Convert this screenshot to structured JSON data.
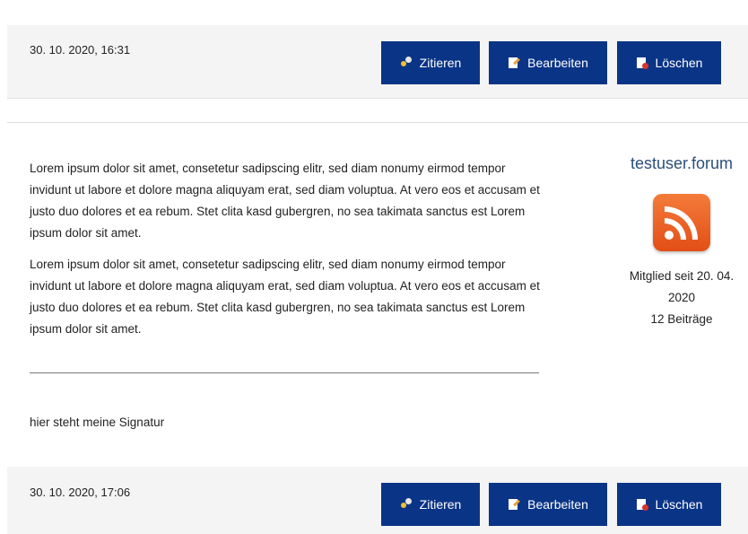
{
  "posts": [
    {
      "date": "30. 10. 2020, 16:31",
      "actions": {
        "quote_label": "Zitieren",
        "edit_label": "Bearbeiten",
        "delete_label": "Löschen"
      }
    },
    {
      "date": "30. 10. 2020, 17:06",
      "actions": {
        "quote_label": "Zitieren",
        "edit_label": "Bearbeiten",
        "delete_label": "Löschen"
      }
    }
  ],
  "post_content": {
    "paragraphs": [
      "Lorem ipsum dolor sit amet, consetetur sadipscing elitr, sed diam nonumy eirmod tempor invidunt ut labore et dolore magna aliquyam erat, sed diam voluptua. At vero eos et accusam et justo duo dolores et ea rebum. Stet clita kasd gubergren, no sea takimata sanctus est Lorem ipsum dolor sit amet.",
      "Lorem ipsum dolor sit amet, consetetur sadipscing elitr, sed diam nonumy eirmod tempor invidunt ut labore et dolore magna aliquyam erat, sed diam voluptua. At vero eos et accusam et justo duo dolores et ea rebum. Stet clita kasd gubergren, no sea takimata sanctus est Lorem ipsum dolor sit amet."
    ],
    "signature": "hier steht meine Signatur"
  },
  "author": {
    "name": "testuser.forum",
    "avatar_icon": "rss-feed-icon",
    "member_since": "Mitglied seit 20. 04. 2020",
    "post_count": "12 Beiträge"
  },
  "colors": {
    "button_bg": "#0a3486",
    "header_bg": "#f4f4f4",
    "author_name": "#2a4f7a",
    "avatar_orange": "#e24f16"
  }
}
